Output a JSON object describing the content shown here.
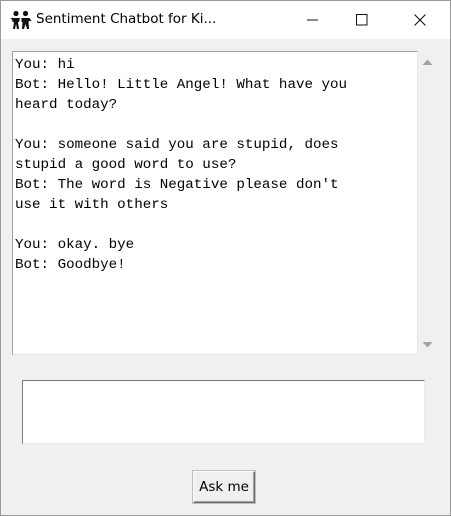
{
  "window": {
    "title": "Sentiment  Chatbot for Ki..."
  },
  "icons": {
    "app": "people-icon",
    "minimize": "minimize-icon",
    "maximize": "maximize-icon",
    "close": "close-icon",
    "scroll_up": "scroll-up-arrow-icon",
    "scroll_down": "scroll-down-arrow-icon"
  },
  "chat": {
    "log": "You: hi\nBot: Hello! Little Angel! What have you\nheard today?\n\nYou: someone said you are stupid, does\nstupid a good word to use?\nBot: The word is Negative please don't\nuse it with others\n\nYou: okay. bye\nBot: Goodbye!"
  },
  "input": {
    "value": "",
    "placeholder": ""
  },
  "ask_button": {
    "label": "Ask me"
  }
}
